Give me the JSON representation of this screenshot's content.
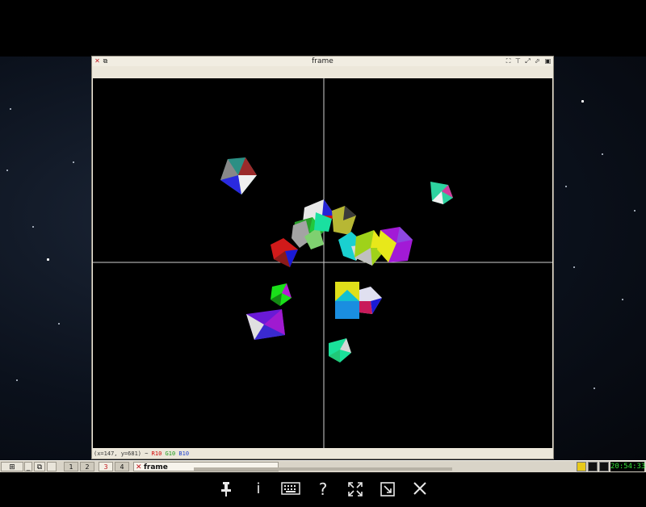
{
  "window": {
    "title": "frame",
    "status": {
      "coords": "(x=147, y=681)",
      "sep": " ~ ",
      "r": "R10",
      "g": "G10",
      "b": "B10"
    }
  },
  "taskbar": {
    "desktops": [
      "1",
      "2",
      "3",
      "4"
    ],
    "active_desktop": "3",
    "task_label": "frame",
    "clock": "20:54:33"
  },
  "bottombar": {
    "icons": [
      "pin-icon",
      "info-icon",
      "keyboard-icon",
      "help-icon",
      "fullscreen-icon",
      "fit-window-icon",
      "close-icon"
    ]
  },
  "scene": {
    "description_colors": [
      "#ff0000",
      "#00ff00",
      "#0000ff",
      "#ffff00",
      "#ff00ff",
      "#00ffff",
      "#ffffff"
    ]
  }
}
